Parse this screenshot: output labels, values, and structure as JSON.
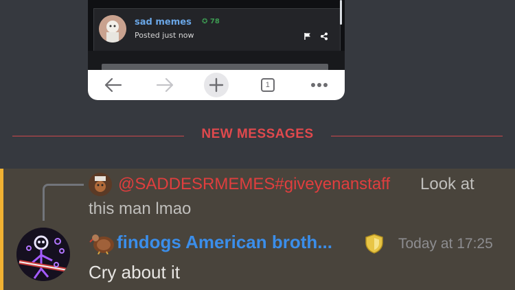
{
  "embed": {
    "username": "sad memes",
    "score": "78",
    "posted": "Posted just now",
    "tab_count": "1",
    "icons": [
      "back-arrow-icon",
      "forward-arrow-icon",
      "new-tab-plus-icon",
      "tab-count-icon",
      "more-dots-icon",
      "flag-icon",
      "share-icon"
    ]
  },
  "divider": {
    "label": "NEW MESSAGES",
    "color": "#e0494d"
  },
  "reply": {
    "mention": "@SADDESRMEMES#giveyenanstaff",
    "text_line1": "Look at",
    "text_line2": "this man lmao"
  },
  "message": {
    "author": "findogs American broth...",
    "timestamp": "Today at 17:25",
    "content": "Cry about it",
    "author_color": "#3b8eea",
    "highlight_accent": "#f0b132"
  }
}
